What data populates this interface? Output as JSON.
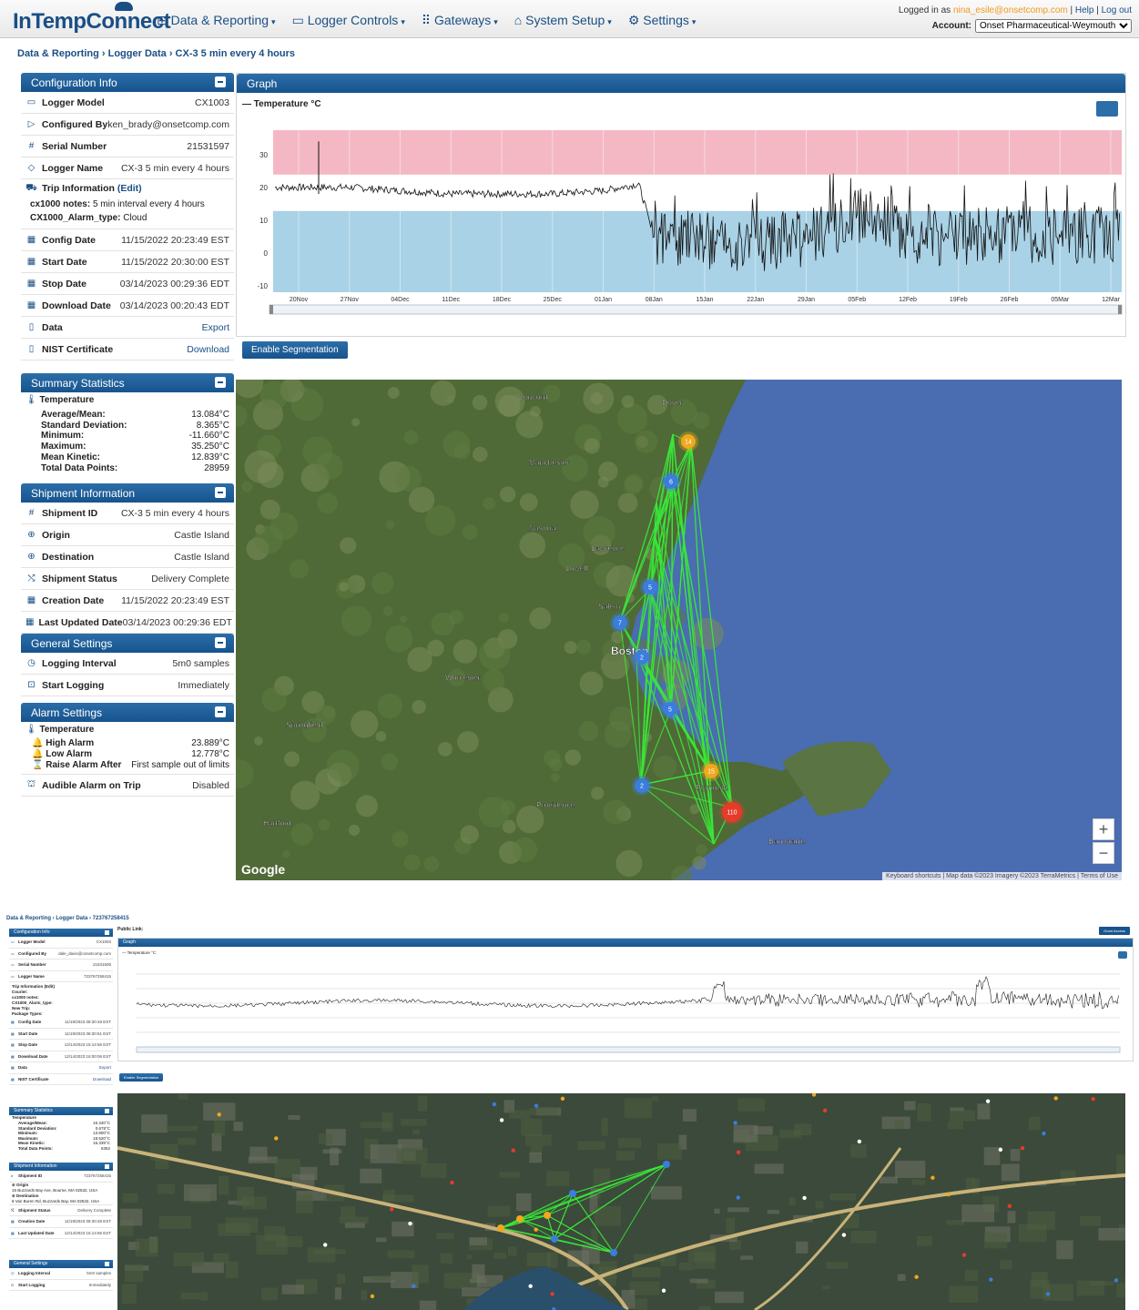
{
  "app": {
    "logo": "InTempConnect",
    "nav": [
      "Data & Reporting",
      "Logger Controls",
      "Gateways",
      "System Setup",
      "Settings"
    ],
    "logged_in_prefix": "Logged in as ",
    "user_email": "nina_esile@onsetcomp.com",
    "help": "Help",
    "logout": "Log out",
    "account_label": "Account:",
    "account_value": "Onset Pharmaceutical-Weymouth"
  },
  "screen1": {
    "breadcrumb": "Data & Reporting › Logger Data › CX-3 5 min every 4 hours",
    "config": {
      "title": "Configuration Info",
      "logger_model_label": "Logger Model",
      "logger_model": "CX1003",
      "configured_by_label": "Configured By",
      "configured_by": "ken_brady@onsetcomp.com",
      "serial_label": "Serial Number",
      "serial": "21531597",
      "logger_name_label": "Logger Name",
      "logger_name": "CX-3 5 min every 4 hours",
      "trip_label": "Trip Information",
      "trip_edit": "(Edit)",
      "notes_label": "cx1000 notes:",
      "notes": "5 min interval every 4 hours",
      "alarm_type_label": "CX1000_Alarm_type:",
      "alarm_type": "Cloud",
      "config_date_label": "Config Date",
      "config_date": "11/15/2022 20:23:49 EST",
      "start_date_label": "Start Date",
      "start_date": "11/15/2022 20:30:00 EST",
      "stop_date_label": "Stop Date",
      "stop_date": "03/14/2023 00:29:36 EDT",
      "download_date_label": "Download Date",
      "download_date": "03/14/2023 00:20:43 EDT",
      "data_label": "Data",
      "data_action": "Export",
      "nist_label": "NIST Certificate",
      "nist_action": "Download"
    },
    "summary": {
      "title": "Summary Statistics",
      "sensor": "Temperature",
      "rows": [
        {
          "k": "Average/Mean:",
          "v": "13.084°C"
        },
        {
          "k": "Standard Deviation:",
          "v": "8.365°C"
        },
        {
          "k": "Minimum:",
          "v": "-11.660°C"
        },
        {
          "k": "Maximum:",
          "v": "35.250°C"
        },
        {
          "k": "Mean Kinetic:",
          "v": "12.839°C"
        },
        {
          "k": "Total Data Points:",
          "v": "28959"
        }
      ]
    },
    "shipment": {
      "title": "Shipment Information",
      "id_label": "Shipment ID",
      "id": "CX-3 5 min every 4 hours",
      "origin_label": "Origin",
      "origin": "Castle Island",
      "dest_label": "Destination",
      "dest": "Castle Island",
      "status_label": "Shipment Status",
      "status": "Delivery Complete",
      "created_label": "Creation Date",
      "created": "11/15/2022 20:23:49 EST",
      "updated_label": "Last Updated Date",
      "updated": "03/14/2023 00:29:36 EDT"
    },
    "general": {
      "title": "General Settings",
      "interval_label": "Logging Interval",
      "interval": "5m0 samples",
      "start_label": "Start Logging",
      "start": "Immediately"
    },
    "alarm": {
      "title": "Alarm Settings",
      "sensor": "Temperature",
      "high_label": "High Alarm",
      "high": "23.889°C",
      "low_label": "Low Alarm",
      "low": "12.778°C",
      "raise_label": "Raise Alarm After",
      "raise": "First sample out of limits",
      "audible_label": "Audible Alarm on Trip",
      "audible": "Disabled"
    },
    "graph": {
      "title": "Graph",
      "legend": "Temperature °C",
      "segment_button": "Enable Segmentation"
    },
    "map": {
      "labels": [
        "Concord",
        "Dover",
        "Manchester",
        "Nashua",
        "Lowell",
        "Lawrence",
        "Salem",
        "Boston",
        "Worcester",
        "Providence",
        "Springfield",
        "Hartford",
        "Barnstable",
        "Plymouth"
      ],
      "clusters": [
        "14",
        "6",
        "5",
        "7",
        "2",
        "5",
        "15",
        "2",
        "110"
      ],
      "footer": "Keyboard shortcuts | Map data ©2023 Imagery ©2023 TerraMetrics | Terms of Use",
      "google": "Google"
    }
  },
  "chart_data": [
    {
      "type": "line",
      "title": "",
      "legend": [
        "Temperature °C"
      ],
      "xlabel": "",
      "ylabel": "",
      "x_ticks": [
        "20Nov",
        "27Nov",
        "04Dec",
        "11Dec",
        "18Dec",
        "25Dec",
        "01Jan",
        "08Jan",
        "15Jan",
        "22Jan",
        "29Jan",
        "05Feb",
        "12Feb",
        "19Feb",
        "26Feb",
        "05Mar",
        "12Mar"
      ],
      "y_ticks": [
        30,
        20,
        10,
        0,
        -10
      ],
      "ylim": [
        -12,
        38
      ],
      "high_alarm": 23.889,
      "low_alarm": 12.778,
      "series": [
        {
          "name": "Temperature °C",
          "x": [
            "15Nov",
            "20Nov",
            "27Nov",
            "04Dec",
            "11Dec",
            "18Dec",
            "25Dec",
            "01Jan",
            "06Jan",
            "08Jan",
            "15Jan",
            "22Jan",
            "29Jan",
            "05Feb",
            "12Feb",
            "19Feb",
            "26Feb",
            "05Mar",
            "12Mar"
          ],
          "values": [
            20,
            20,
            20,
            19,
            18,
            18,
            18,
            19,
            21,
            5,
            4,
            3,
            4,
            12,
            6,
            4,
            6,
            5,
            6
          ]
        }
      ],
      "colors": {
        "line": "#111111",
        "high_band": "#f4b8c4",
        "low_band": "#a9d2e6"
      }
    },
    {
      "type": "line",
      "title": "",
      "legend": [
        "Temperature °C"
      ],
      "series": [
        {
          "name": "Temperature °C"
        }
      ]
    }
  ],
  "screen2": {
    "breadcrumb": "Data & Reporting › Logger Data › 723767258415",
    "public_link": "Public Link:",
    "share_button": "Grant Access",
    "config": {
      "title": "Configuration Info",
      "rows": [
        {
          "k": "Logger Model",
          "v": "CX1003"
        },
        {
          "k": "Configured By",
          "v": "dale_davis@onsetcomp.com"
        },
        {
          "k": "Serial Number",
          "v": "21631506"
        },
        {
          "k": "Logger Name",
          "v": "723767258415"
        }
      ],
      "trip": "Trip Information (Edit)",
      "trip_lines": [
        "Courier:",
        "cx1000 notes:",
        "CX1000_Alarm_type:",
        "New Trip:",
        "Package Types:"
      ],
      "dates": [
        {
          "k": "Config Date",
          "v": "11/19/2023 08:30:48 EST"
        },
        {
          "k": "Start Date",
          "v": "11/19/2023 08:30:51 EST"
        },
        {
          "k": "Stop Date",
          "v": "12/14/2023 15:14:56 EST"
        },
        {
          "k": "Download Date",
          "v": "12/14/2023 16:00:06 EST"
        },
        {
          "k": "Data",
          "v": "Export"
        },
        {
          "k": "NIST Certificate",
          "v": "Download"
        }
      ]
    },
    "summary": {
      "title": "Summary Statistics",
      "sensor": "Temperature",
      "rows": [
        {
          "k": "Average/Mean:",
          "v": "16.340°C"
        },
        {
          "k": "Standard Deviation:",
          "v": "0.678°C"
        },
        {
          "k": "Minimum:",
          "v": "13.800°C"
        },
        {
          "k": "Maximum:",
          "v": "18.520°C"
        },
        {
          "k": "Mean Kinetic:",
          "v": "16.339°C"
        },
        {
          "k": "Total Data Points:",
          "v": "6352"
        }
      ]
    },
    "shipment": {
      "title": "Shipment Information",
      "id_label": "Shipment ID",
      "id": "723767258415",
      "origin_label": "Origin",
      "origin": "15 Buzzards Bay Ave, Bourne, MA 02532, USA",
      "dest_label": "Destination",
      "dest": "8 Van Buren Rd, Buzzards Bay, MA 02532, USA",
      "status_label": "Shipment Status",
      "status": "Delivery Complete",
      "created_label": "Creation Date",
      "created": "11/19/2023 08:30:48 EST",
      "updated_label": "Last Updated Date",
      "updated": "12/14/2023 15:14:56 EST"
    },
    "general": {
      "title": "General Settings",
      "interval_label": "Logging Interval",
      "interval": "5m0 samples",
      "start_label": "Start Logging",
      "start": "Immediately"
    },
    "graph": {
      "title": "Graph",
      "legend": "Temperature °C",
      "segment_button": "Enable Segmentation"
    }
  }
}
